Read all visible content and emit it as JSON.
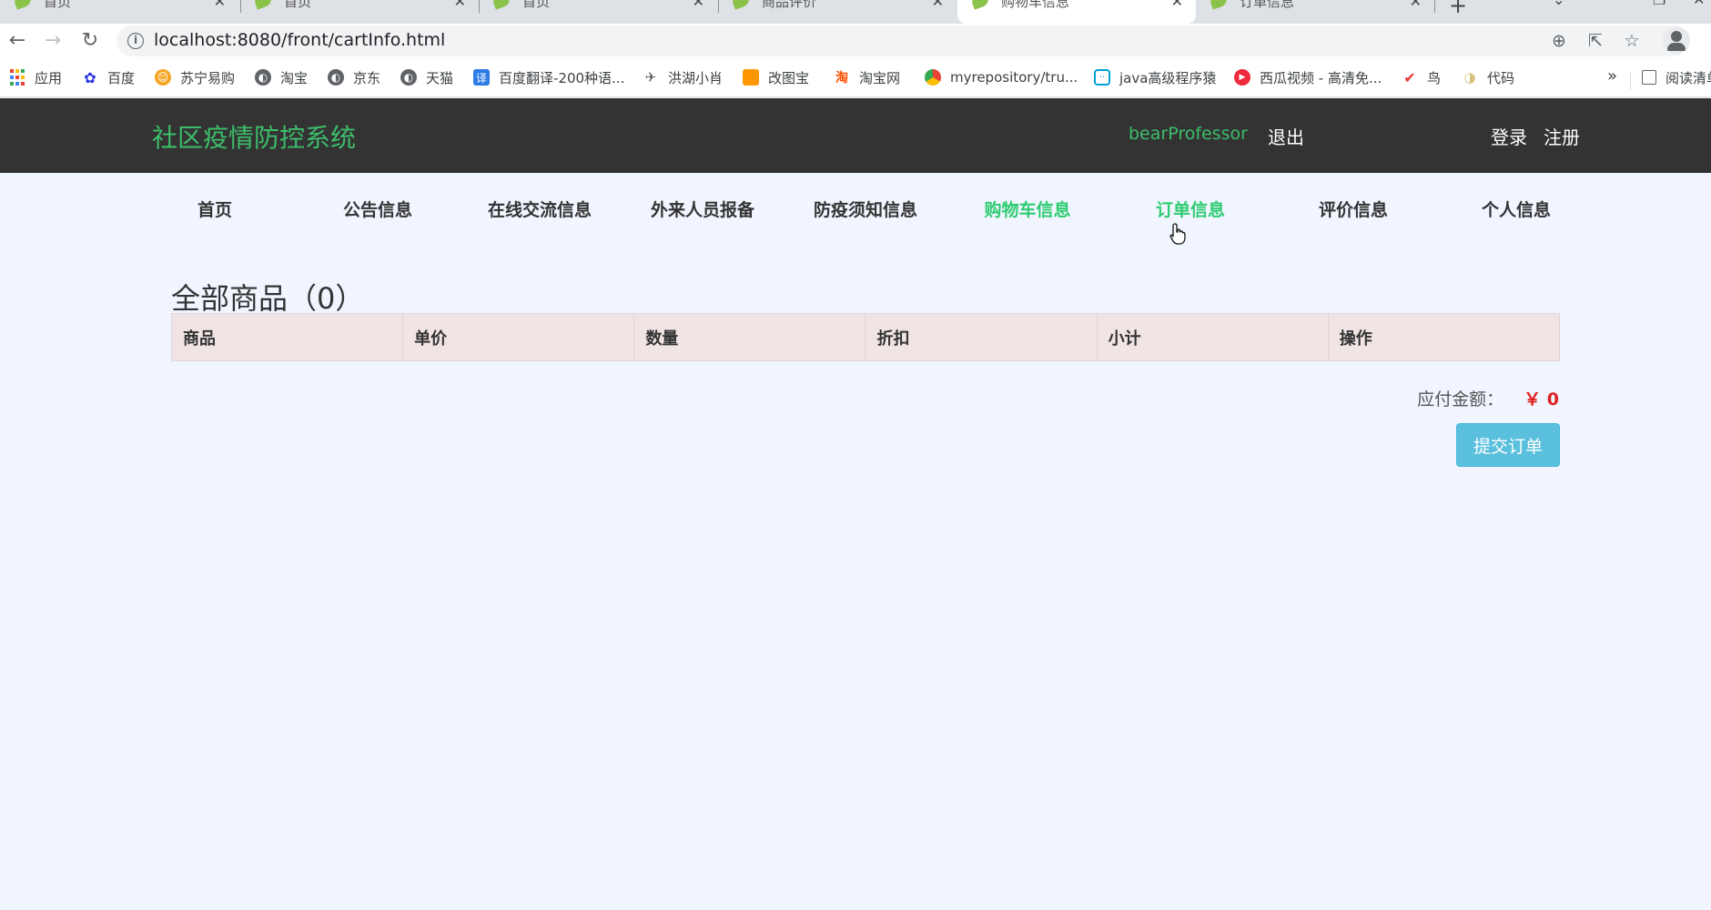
{
  "browser": {
    "tabs": [
      {
        "title": "首页"
      },
      {
        "title": "首页"
      },
      {
        "title": "首页"
      },
      {
        "title": "商品评价"
      },
      {
        "title": "购物车信息",
        "active": true
      },
      {
        "title": "订单信息"
      }
    ],
    "url": "localhost:8080/front/cartInfo.html",
    "bookmarks": [
      {
        "label": "应用",
        "icon": "apps-grid-icon"
      },
      {
        "label": "百度",
        "icon": "baidu-paw-icon"
      },
      {
        "label": "苏宁易购",
        "icon": "suning-lion-icon"
      },
      {
        "label": "淘宝",
        "icon": "globe-icon"
      },
      {
        "label": "京东",
        "icon": "globe-icon"
      },
      {
        "label": "天猫",
        "icon": "globe-icon"
      },
      {
        "label": "百度翻译-200种语...",
        "icon": "baidu-translate-icon"
      },
      {
        "label": "洪湖小肖",
        "icon": "bird-icon"
      },
      {
        "label": "改图宝",
        "icon": "gaitubao-icon"
      },
      {
        "label": "淘宝网",
        "icon": "taobao-icon"
      },
      {
        "label": "myrepository/tru...",
        "icon": "chrome-icon"
      },
      {
        "label": "java高级程序猿",
        "icon": "bilibili-icon"
      },
      {
        "label": "西瓜视频 - 高清免...",
        "icon": "xigua-play-icon"
      },
      {
        "label": "鸟",
        "icon": "bird-red-icon"
      },
      {
        "label": "代码",
        "icon": "code-icon"
      }
    ],
    "bookmarks_more": "»",
    "reading_list": "阅读清单"
  },
  "header": {
    "brand": "社区疫情防控系统",
    "username": "bearProfessor",
    "logout": "退出",
    "login": "登录",
    "register": "注册"
  },
  "nav": {
    "items": [
      {
        "label": "首页"
      },
      {
        "label": "公告信息"
      },
      {
        "label": "在线交流信息"
      },
      {
        "label": "外来人员报备"
      },
      {
        "label": "防疫须知信息"
      },
      {
        "label": "购物车信息",
        "active": true
      },
      {
        "label": "订单信息"
      },
      {
        "label": "评价信息"
      },
      {
        "label": "个人信息"
      }
    ]
  },
  "cart": {
    "title": "全部商品（0）",
    "columns": [
      "商品",
      "单价",
      "数量",
      "折扣",
      "小计",
      "操作"
    ],
    "total_label": "应付金额：",
    "total_value": "￥ 0",
    "submit_label": "提交订单"
  },
  "colors": {
    "brand_green": "#3dbd6a",
    "nav_active": "#2ecc71",
    "header_bg": "#333333",
    "page_bg": "#f0f5ff",
    "table_header_bg": "#f1e4e4",
    "price_red": "#e02020",
    "submit_button": "#5bc0de"
  }
}
